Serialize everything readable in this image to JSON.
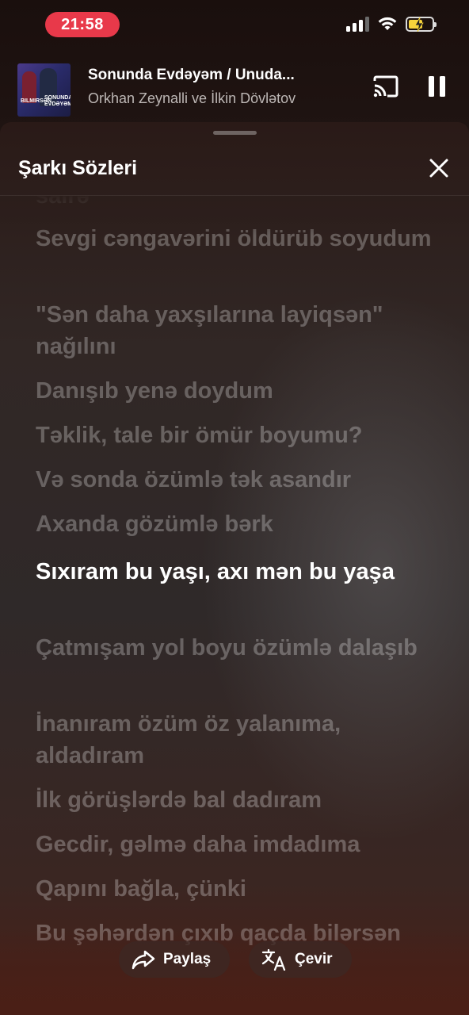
{
  "status_bar": {
    "time": "21:58",
    "icons": [
      "signal-icon",
      "wifi-icon",
      "battery-charging-icon"
    ]
  },
  "now_playing": {
    "title": "Sonunda Evdəyəm / Unuda...",
    "artist": "Orkhan Zeynalli ve İlkin Dövlətov",
    "album_art_text_1": "BILMIRSƏN",
    "album_art_text_2": "SONUNDA EVDƏYƏM",
    "cast_icon": "cast-icon",
    "pause_icon": "pause-icon"
  },
  "lyrics_sheet": {
    "title": "Şarkı Sözleri",
    "close_icon": "close-icon",
    "lines": [
      {
        "text": "sairə",
        "active": false
      },
      {
        "text": "Sevgi cəngavərini öldürüb soyudum",
        "active": false
      },
      {
        "text": "\"Sən daha yaxşılarına layiqsən\" nağılını",
        "active": false
      },
      {
        "text": "Danışıb yenə doydum",
        "active": false
      },
      {
        "text": "Təklik, tale bir ömür boyumu?",
        "active": false
      },
      {
        "text": "Və sonda özümlə tək asandır",
        "active": false
      },
      {
        "text": "Axanda gözümlə bərk",
        "active": false
      },
      {
        "text": "Sıxıram bu yaşı, axı mən bu yaşa",
        "active": true
      },
      {
        "text": "Çatmışam yol boyu özümlə dalaşıb",
        "active": false
      },
      {
        "text": "İnanıram özüm öz yalanıma, aldadıram",
        "active": false
      },
      {
        "text": "İlk görüşlərdə bal dadıram",
        "active": false
      },
      {
        "text": "Gecdir, gəlmə daha imdadıma",
        "active": false
      },
      {
        "text": "Qapını bağla, çünki",
        "active": false
      },
      {
        "text": "Bu şəhərdən çıxıb qaçda bilərsən",
        "active": false
      }
    ],
    "share_label": "Paylaş",
    "translate_label": "Çevir"
  }
}
